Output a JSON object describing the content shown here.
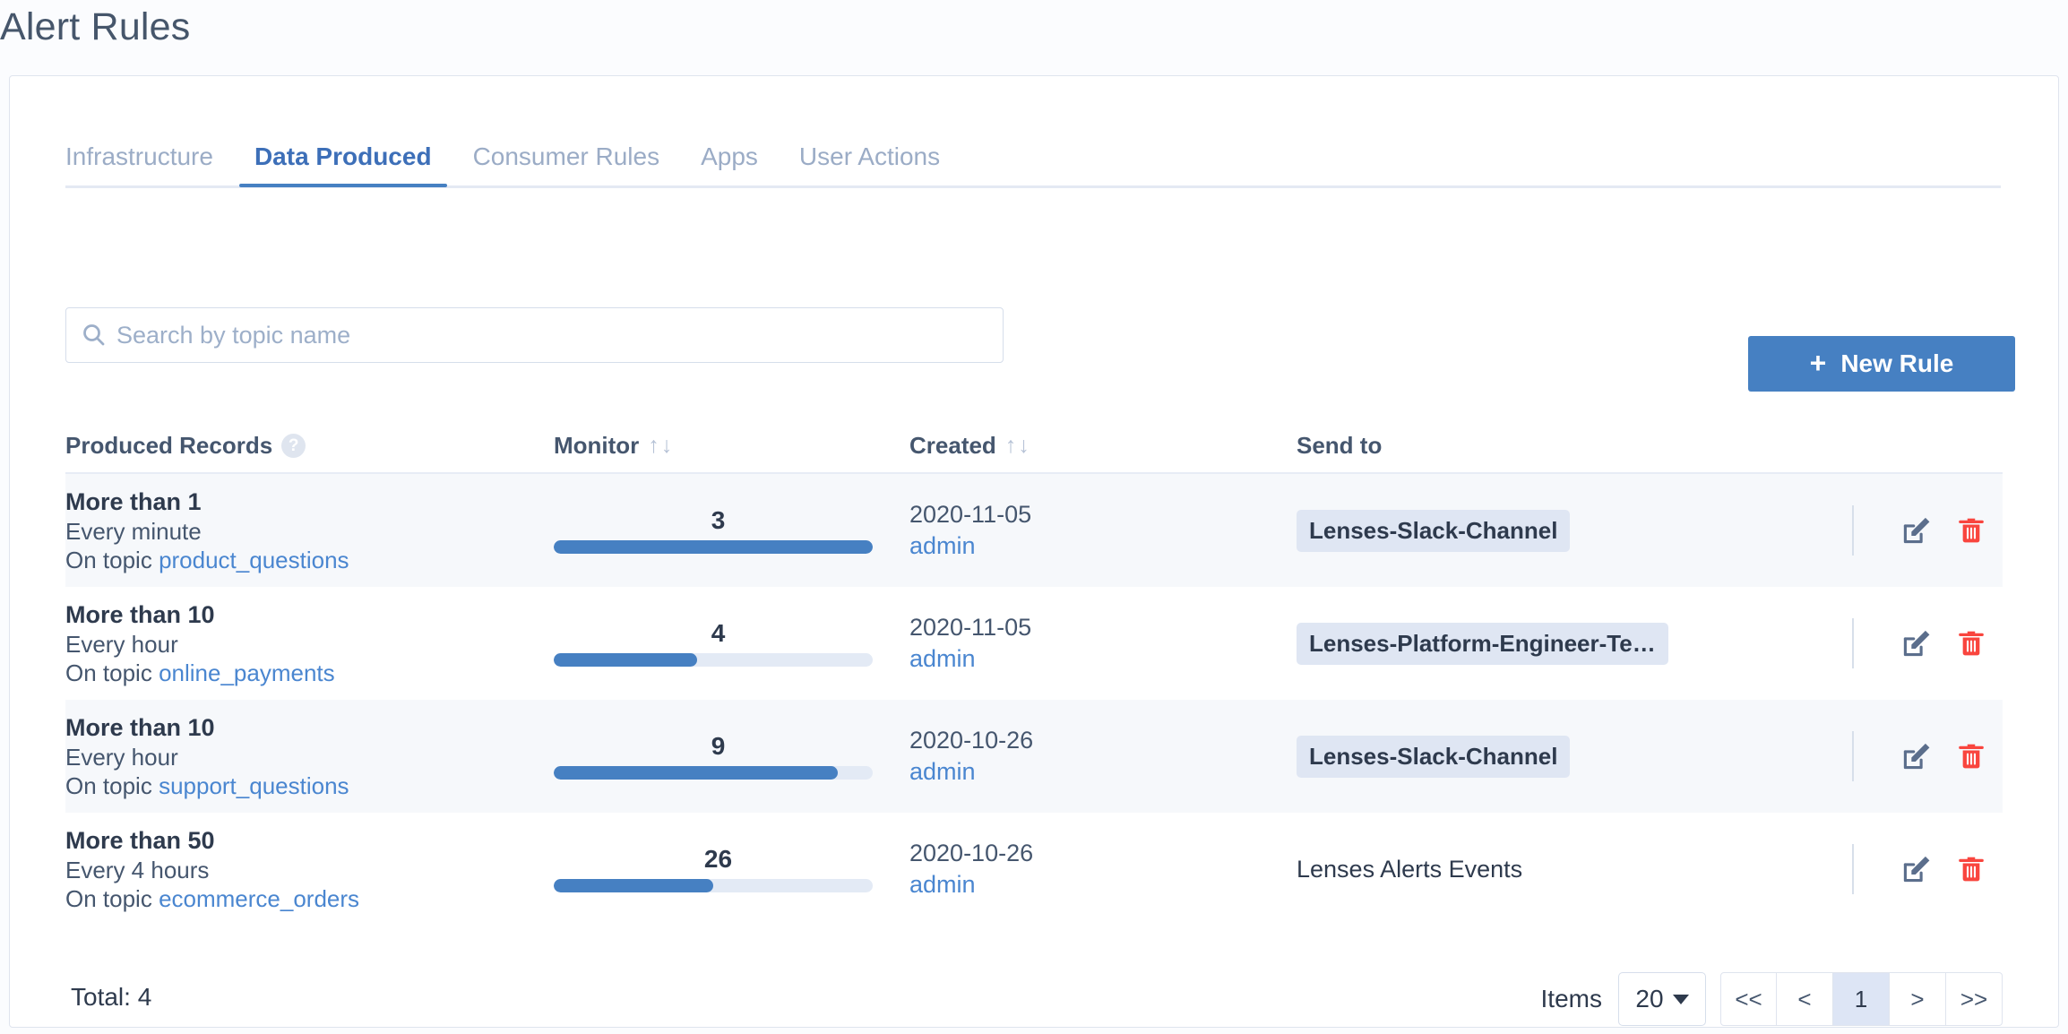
{
  "page": {
    "title": "Alert Rules"
  },
  "tabs": [
    {
      "label": "Infrastructure",
      "active": false
    },
    {
      "label": "Data Produced",
      "active": true
    },
    {
      "label": "Consumer Rules",
      "active": false
    },
    {
      "label": "Apps",
      "active": false
    },
    {
      "label": "User Actions",
      "active": false
    }
  ],
  "toolbar": {
    "search_placeholder": "Search by topic name",
    "search_value": "",
    "search_icon": "search-icon",
    "new_rule_label": "New Rule",
    "new_rule_plus": "+"
  },
  "table": {
    "headers": {
      "rule": "Produced Records",
      "rule_help": "?",
      "monitor": "Monitor",
      "created": "Created",
      "sendto": "Send to",
      "sort_up": "↑",
      "sort_down": "↓"
    },
    "rows": [
      {
        "threshold": "More than 1",
        "frequency": "Every minute",
        "topic_prefix": "On topic ",
        "topic": "product_questions",
        "monitor_value": "3",
        "monitor_percent": 100,
        "created_date": "2020-11-05",
        "created_user": "admin",
        "send_to": "Lenses-Slack-Channel",
        "send_to_badge": true
      },
      {
        "threshold": "More than 10",
        "frequency": "Every hour",
        "topic_prefix": "On topic ",
        "topic": "online_payments",
        "monitor_value": "4",
        "monitor_percent": 45,
        "created_date": "2020-11-05",
        "created_user": "admin",
        "send_to": "Lenses-Platform-Engineer-Te…",
        "send_to_badge": true
      },
      {
        "threshold": "More than 10",
        "frequency": "Every hour",
        "topic_prefix": "On topic ",
        "topic": "support_questions",
        "monitor_value": "9",
        "monitor_percent": 89,
        "created_date": "2020-10-26",
        "created_user": "admin",
        "send_to": "Lenses-Slack-Channel",
        "send_to_badge": true
      },
      {
        "threshold": "More than 50",
        "frequency": "Every 4 hours",
        "topic_prefix": "On topic ",
        "topic": "ecommerce_orders",
        "monitor_value": "26",
        "monitor_percent": 50,
        "created_date": "2020-10-26",
        "created_user": "admin",
        "send_to": "Lenses Alerts Events",
        "send_to_badge": false
      }
    ],
    "row_actions": {
      "edit_icon": "edit-icon",
      "delete_icon": "trash-icon"
    }
  },
  "footer": {
    "total_label": "Total: 4",
    "items_label": "Items",
    "items_value": "20",
    "pager": [
      {
        "label": "<<",
        "name": "first-page-button",
        "current": false
      },
      {
        "label": "<",
        "name": "previous-page-button",
        "current": false
      },
      {
        "label": "1",
        "name": "page-1-button",
        "current": true
      },
      {
        "label": ">",
        "name": "next-page-button",
        "current": false
      },
      {
        "label": ">>",
        "name": "last-page-button",
        "current": false
      }
    ]
  },
  "colors": {
    "accent": "#4680c2",
    "link": "#4a86d0",
    "text": "#2e3a4d",
    "muted": "#9bacc6",
    "danger": "#f9453e",
    "badge_bg": "#dfe6f3",
    "row_alt": "#f6f8fb",
    "page_bg": "#fbfcfe"
  }
}
